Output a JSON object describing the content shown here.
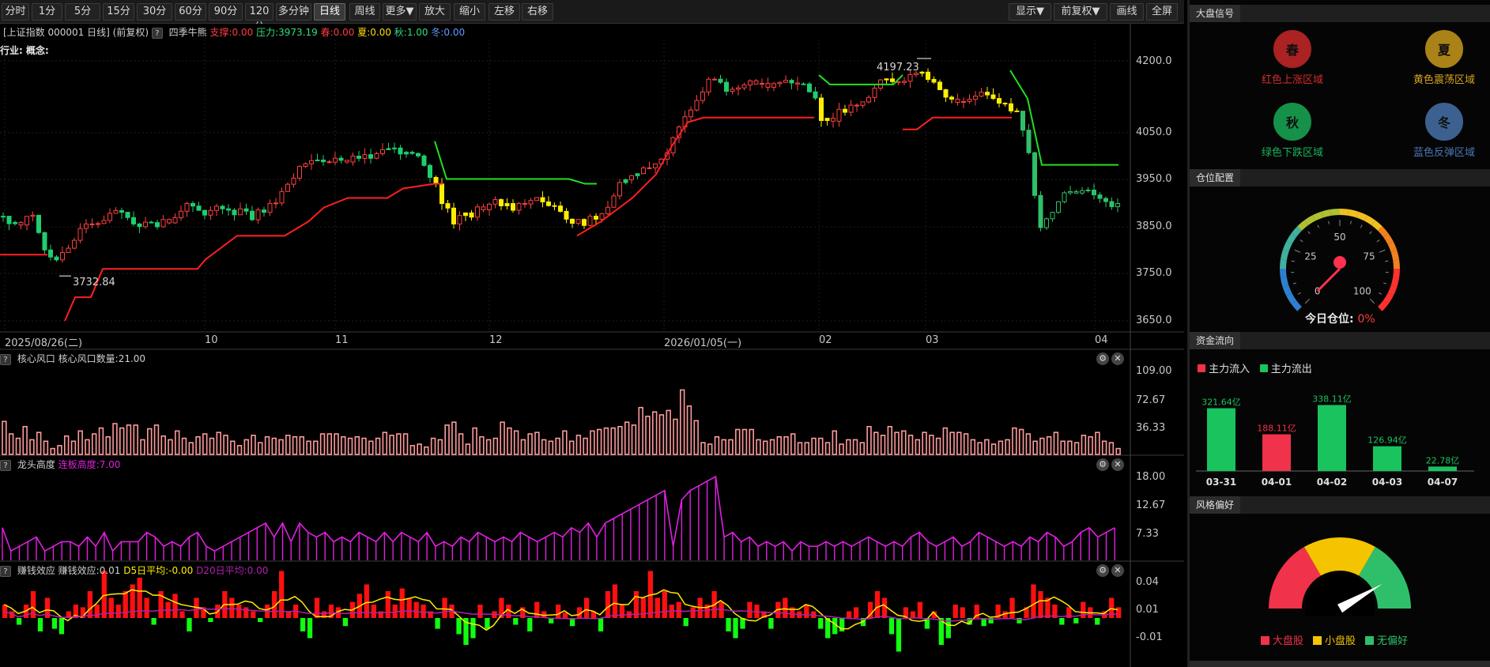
{
  "toolbar": {
    "left": [
      {
        "label": "分时",
        "name": "period-timeshare-button"
      },
      {
        "label": "1分",
        "name": "period-1min-button"
      },
      {
        "label": "5分",
        "name": "period-5min-button"
      },
      {
        "label": "15分",
        "name": "period-15min-button"
      },
      {
        "label": "30分",
        "name": "period-30min-button"
      },
      {
        "label": "60分",
        "name": "period-60min-button"
      },
      {
        "label": "90分",
        "name": "period-90min-button"
      },
      {
        "label": "120分",
        "name": "period-120min-button"
      },
      {
        "label": "多分钟",
        "name": "period-multimin-button"
      },
      {
        "label": "日线",
        "name": "period-daily-button",
        "active": true
      },
      {
        "label": "周线",
        "name": "period-weekly-button"
      },
      {
        "label": "更多▼",
        "name": "period-more-button"
      },
      {
        "label": "放大",
        "name": "zoom-in-button"
      },
      {
        "label": "缩小",
        "name": "zoom-out-button"
      },
      {
        "label": "左移",
        "name": "move-left-button"
      },
      {
        "label": "右移",
        "name": "move-right-button"
      }
    ],
    "right": [
      {
        "label": "显示▼",
        "name": "display-menu-button"
      },
      {
        "label": "前复权▼",
        "name": "adjust-menu-button"
      },
      {
        "label": "画线",
        "name": "draw-line-button"
      },
      {
        "label": "全屏",
        "name": "fullscreen-button"
      }
    ]
  },
  "header": {
    "symbol": "[上证指数 000001 日线]",
    "adjust": "(前复权)",
    "help": "?",
    "indicator": "四季牛熊",
    "support": "支撑:0.00",
    "pressure": "压力:3973.19",
    "spring": "春:0.00",
    "summer": "夏:0.00",
    "autumn": "秋:1.00",
    "winter": "冬:0.00",
    "industry": "行业:",
    "concept": "概念:"
  },
  "price_axis": [
    "4200.0",
    "4050.0",
    "3950.0",
    "3850.0",
    "3750.0",
    "3650.0"
  ],
  "annotations": {
    "high": "4197.23",
    "low": "3732.84"
  },
  "date_axis": [
    "2025/08/26(二)",
    "10",
    "11",
    "12",
    "2026/01/05(一)",
    "02",
    "03",
    "04"
  ],
  "panel1": {
    "help": "?",
    "title": "核心风口",
    "value": "核心风口数量:21.00",
    "axis": [
      "109.00",
      "72.67",
      "36.33"
    ],
    "values": [
      45,
      28,
      22,
      38,
      20,
      30,
      18,
      8,
      12,
      25,
      18,
      32,
      20,
      28,
      36,
      24,
      42,
      36,
      40,
      40,
      20,
      35,
      40,
      25,
      20,
      32,
      22,
      16,
      24,
      28,
      22,
      30,
      26,
      18,
      12,
      20,
      26,
      16,
      24,
      22,
      20,
      26,
      24,
      24,
      18,
      18,
      28,
      28,
      28,
      24,
      22,
      24,
      22,
      18,
      22,
      30,
      26,
      28,
      28,
      12,
      14,
      10,
      22,
      20,
      40,
      44,
      28,
      14,
      36,
      24,
      20,
      22,
      44,
      36,
      32,
      20,
      28,
      30,
      20,
      18,
      22,
      32,
      18,
      26,
      22,
      32,
      34,
      36,
      36,
      38,
      44,
      40,
      64,
      52,
      58,
      54,
      60,
      48,
      88,
      66,
      46,
      16,
      14,
      24,
      20,
      20,
      34,
      34,
      34,
      20,
      18,
      20,
      24,
      24,
      28,
      16,
      16,
      22,
      22,
      16,
      32,
      14,
      20,
      20,
      16,
      38,
      30,
      26,
      38,
      30,
      32,
      26,
      20,
      30,
      26,
      22,
      36,
      30,
      30,
      28,
      20,
      16,
      20,
      14,
      18,
      20,
      36,
      34,
      28,
      18,
      22,
      24,
      30,
      18,
      18,
      16,
      26,
      24,
      30,
      18,
      16,
      8
    ]
  },
  "panel2": {
    "help": "?",
    "title": "龙头高度",
    "value": "连板高度:7.00",
    "axis": [
      "18.00",
      "12.67",
      "7.33"
    ],
    "values": [
      7,
      2,
      3,
      4,
      5,
      2,
      3,
      4,
      4,
      3,
      5,
      3,
      6,
      2,
      4,
      4,
      4,
      6,
      5,
      3,
      4,
      3,
      5,
      6,
      3,
      2,
      3,
      4,
      5,
      6,
      7,
      8,
      5,
      8,
      4,
      8,
      6,
      5,
      6,
      4,
      5,
      4,
      6,
      5,
      4,
      6,
      4,
      6,
      5,
      4,
      6,
      3,
      4,
      3,
      5,
      4,
      6,
      5,
      4,
      5,
      4,
      6,
      5,
      4,
      5,
      6,
      5,
      7,
      6,
      8,
      5,
      8,
      9,
      10,
      11,
      12,
      13,
      14,
      15,
      3,
      13,
      15,
      16,
      17,
      18,
      5,
      6,
      4,
      5,
      3,
      4,
      3,
      4,
      2,
      4,
      3,
      3,
      4,
      3,
      4,
      3,
      4,
      5,
      4,
      3,
      4,
      3,
      5,
      6,
      4,
      3,
      4,
      5,
      3,
      4,
      6,
      5,
      4,
      3,
      4,
      3,
      5,
      4,
      6,
      5,
      3,
      4,
      6,
      7,
      5,
      6,
      7
    ]
  },
  "panel3": {
    "help": "?",
    "title": "赚钱效应",
    "value": "赚钱效应:0.01",
    "d5": "D5日平均:-0.00",
    "d20": "D20日平均:0.00",
    "axis": [
      "0.04",
      "0.01",
      "-0.01"
    ],
    "values": [
      0.01,
      0.005,
      -0.005,
      0.01,
      0.02,
      -0.01,
      0.015,
      -0.008,
      -0.012,
      0.005,
      0.01,
      0.008,
      0.02,
      0.01,
      0.035,
      0.015,
      0.01,
      0.02,
      0.025,
      0.03,
      0.015,
      -0.005,
      0.02,
      0.012,
      0.018,
      0.005,
      -0.01,
      0.015,
      0.008,
      -0.003,
      0.01,
      0.02,
      0.015,
      0.01,
      0.008,
      0.005,
      -0.003,
      0.01,
      0.02,
      0.035,
      0.005,
      0.01,
      -0.01,
      -0.015,
      0.015,
      0.005,
      0.01,
      0.008,
      -0.006,
      0.012,
      0.018,
      0.025,
      0.01,
      0.005,
      0.02,
      0.01,
      0.022,
      0.015,
      0.012,
      0.01,
      0.005,
      -0.008,
      0.015,
      0.01,
      -0.012,
      -0.02,
      -0.015,
      0.01,
      -0.008,
      0.005,
      0.015,
      0.01,
      -0.005,
      0.008,
      -0.01,
      0.012,
      0.005,
      -0.004,
      0.01,
      0.004,
      -0.006,
      0.008,
      0.015,
      0.005,
      -0.01,
      0.02,
      0.025,
      0.01,
      0.005,
      0.02,
      0.015,
      0.035,
      0.015,
      0.02,
      0.01,
      0.012,
      -0.006,
      0.008,
      0.015,
      0.01,
      0.02,
      0.012,
      -0.01,
      -0.015,
      -0.008,
      0.012,
      0.01,
      0.005,
      -0.008,
      0.012,
      0.015,
      0.008,
      0.005,
      0.01,
      0.005,
      -0.008,
      -0.015,
      -0.012,
      -0.01,
      0.005,
      0.008,
      -0.006,
      0.012,
      0.02,
      0.015,
      -0.012,
      -0.025,
      0.008,
      0.005,
      0.012,
      -0.008,
      0.005,
      -0.02,
      -0.015,
      0.01,
      0.008,
      -0.005,
      0.01,
      -0.006,
      -0.004,
      0.01,
      0.005,
      0.015,
      -0.004,
      0.008,
      0.025,
      0.02,
      0.015,
      0.01,
      -0.005,
      0.008,
      -0.004,
      0.012,
      0.008,
      -0.005,
      0.005,
      0.015,
      0.008
    ]
  },
  "sidebar": {
    "signals": {
      "title": "大盘信号",
      "seasons": [
        {
          "glyph": "春",
          "label": "红色上涨区域",
          "color": "#d42a2a"
        },
        {
          "glyph": "夏",
          "label": "黄色震荡区域",
          "color": "#d4a21c"
        },
        {
          "glyph": "秋",
          "label": "绿色下跌区域",
          "color": "#19b45a"
        },
        {
          "glyph": "冬",
          "label": "蓝色反弹区域",
          "color": "#4a78b4"
        }
      ]
    },
    "position": {
      "title": "仓位配置",
      "ticks": [
        "0",
        "25",
        "50",
        "75",
        "100"
      ],
      "today_label": "今日仓位:",
      "today_value": "0%",
      "value": 0
    },
    "flow": {
      "title": "资金流向",
      "legend_in": "主力流入",
      "legend_out": "主力流出",
      "bars": [
        {
          "date": "03-31",
          "label": "321.64亿",
          "value": 321.64,
          "dir": "out"
        },
        {
          "date": "04-01",
          "label": "188.11亿",
          "value": 188.11,
          "dir": "in"
        },
        {
          "date": "04-02",
          "label": "338.11亿",
          "value": 338.11,
          "dir": "out"
        },
        {
          "date": "04-03",
          "label": "126.94亿",
          "value": 126.94,
          "dir": "out"
        },
        {
          "date": "04-07",
          "label": "22.78亿",
          "value": 22.78,
          "dir": "out"
        }
      ]
    },
    "style": {
      "title": "风格偏好",
      "legend": [
        {
          "label": "大盘股",
          "color": "#f0324a"
        },
        {
          "label": "小盘股",
          "color": "#f5c400"
        },
        {
          "label": "无偏好",
          "color": "#2fbf6a"
        }
      ]
    }
  },
  "colors": {
    "up": "#ff4040",
    "down": "#1fce6e",
    "yellow": "#ffee00",
    "magenta": "#e020e0",
    "pink": "#ff9a9a"
  }
}
